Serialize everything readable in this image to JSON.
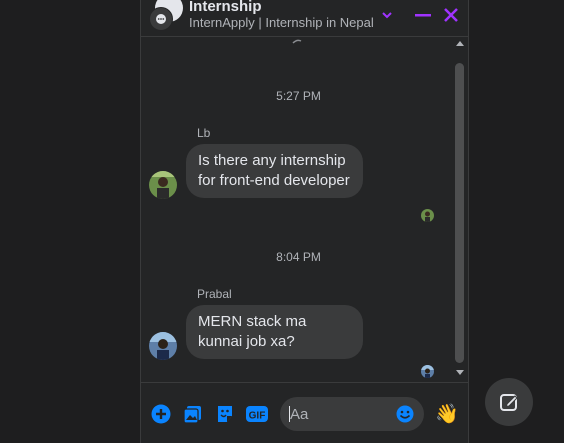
{
  "header": {
    "title": "Internship",
    "subtitle": "InternApply | Internship in Nepal"
  },
  "messages": [
    {
      "time": "5:27 PM",
      "sender": "Lb",
      "text": "Is there any internship for front-end developer"
    },
    {
      "time": "8:04 PM",
      "sender": "Prabal",
      "text": "MERN stack ma kunnai job xa?"
    }
  ],
  "composer": {
    "placeholder": "Aa",
    "reaction_emoji": "👋"
  },
  "colors": {
    "accent": "#a033ff",
    "blue": "#0a84ff",
    "panel": "#242526",
    "bubble": "#3a3b3c"
  }
}
